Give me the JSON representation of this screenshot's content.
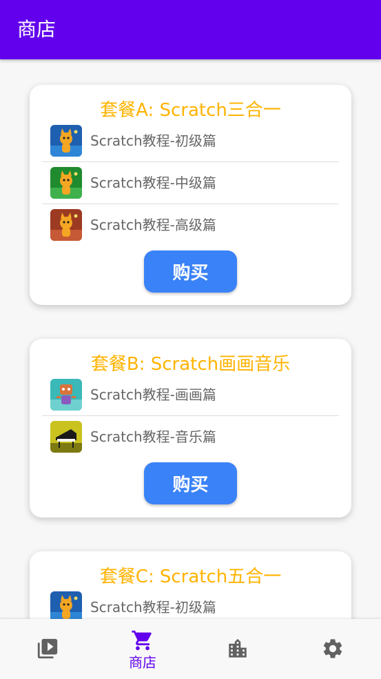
{
  "appbar": {
    "title": "商店"
  },
  "packages": [
    {
      "title": "套餐A: Scratch三合一",
      "items": [
        {
          "label": "Scratch教程-初级篇",
          "thumb": "cat-blue"
        },
        {
          "label": "Scratch教程-中级篇",
          "thumb": "cat-green"
        },
        {
          "label": "Scratch教程-高级篇",
          "thumb": "cat-red"
        }
      ],
      "buy_label": "购买"
    },
    {
      "title": "套餐B: Scratch画画音乐",
      "items": [
        {
          "label": "Scratch教程-画画篇",
          "thumb": "robot-teal"
        },
        {
          "label": "Scratch教程-音乐篇",
          "thumb": "piano-yellow"
        }
      ],
      "buy_label": "购买"
    },
    {
      "title": "套餐C: Scratch五合一",
      "items": [
        {
          "label": "Scratch教程-初级篇",
          "thumb": "cat-blue"
        }
      ],
      "buy_label": ""
    }
  ],
  "bottom_nav": {
    "items": [
      {
        "icon": "video-library-icon",
        "label": ""
      },
      {
        "icon": "shopping-cart-icon",
        "label": "商店",
        "active": true
      },
      {
        "icon": "building-icon",
        "label": ""
      },
      {
        "icon": "gear-icon",
        "label": ""
      }
    ]
  },
  "colors": {
    "primary": "#6200ee",
    "title_accent": "#ffb300",
    "buy_button": "#3a82f7",
    "nav_inactive": "#616161"
  }
}
